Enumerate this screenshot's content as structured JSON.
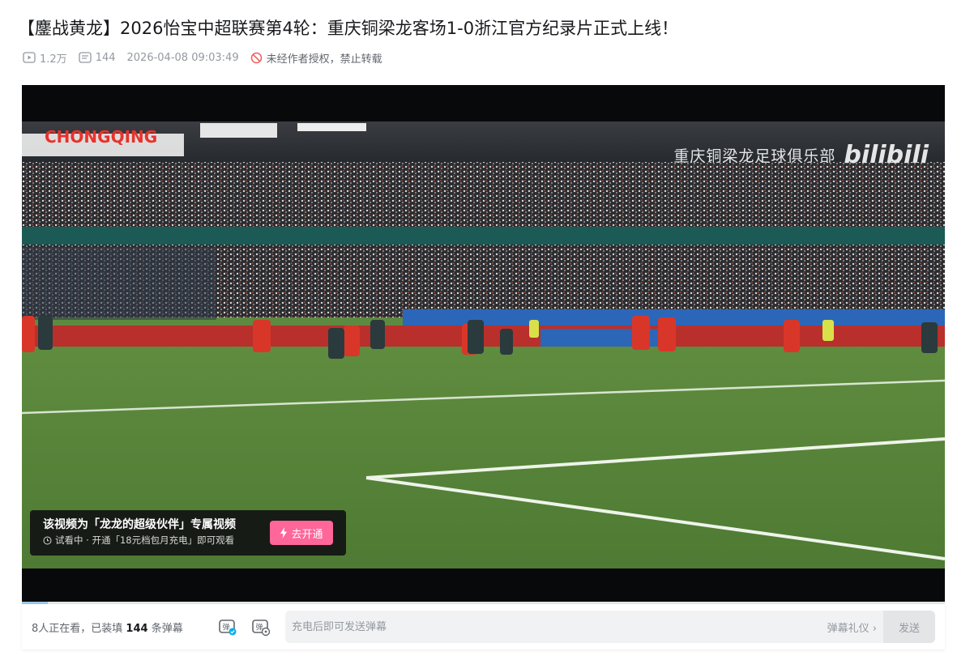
{
  "video": {
    "title": "【鏖战黄龙】2026怡宝中超联赛第4轮：重庆铜梁龙客场1-0浙江官方纪录片正式上线！",
    "views": "1.2万",
    "danmaku_count": "144",
    "publish_time": "2026-04-08 09:03:49",
    "copyright_notice": "未经作者授权，禁止转载"
  },
  "player": {
    "watermark_text": "重庆铜梁龙足球俱乐部",
    "watermark_brand": "bilibili",
    "promo": {
      "title": "该视频为「龙龙的超级伙伴」专属视频",
      "subtitle": "试看中 · 开通「18元档包月充电」即可观看",
      "button": "去开通"
    },
    "progress_fraction": 0.028
  },
  "danmaku_bar": {
    "watching_prefix": "8人正在看，已装填",
    "watching_count": "144",
    "watching_suffix": "条弹幕",
    "input_placeholder": "充电后即可发送弹幕",
    "etiquette_label": "弹幕礼仪 ›",
    "send_label": "发送"
  },
  "colors": {
    "accent_pink": "#ff6699",
    "text_gray": "#9499a0",
    "copyright_red": "#f25d5d"
  },
  "icons": [
    "play-count-icon",
    "danmaku-count-icon",
    "no-repost-icon",
    "lightning-icon",
    "clock-icon",
    "danmaku-toggle-icon",
    "danmaku-settings-icon"
  ]
}
